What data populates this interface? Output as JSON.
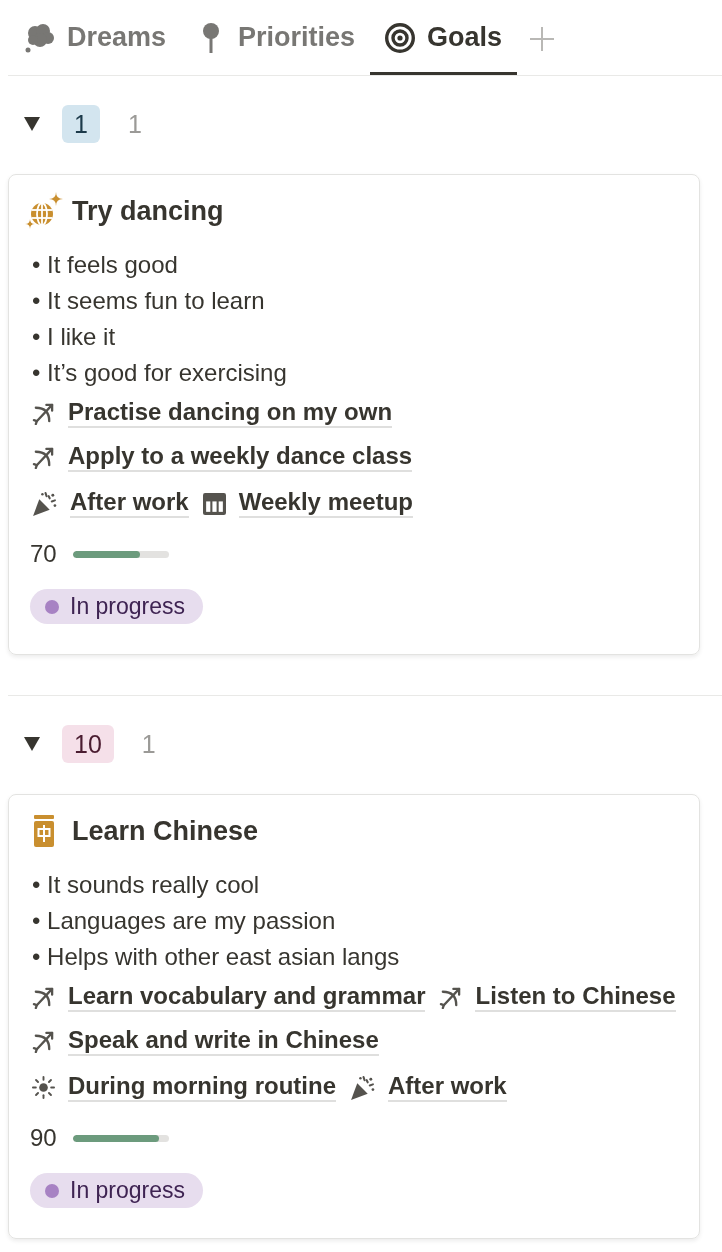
{
  "tabs": [
    {
      "label": "Dreams",
      "kind": "cloud",
      "selected": false
    },
    {
      "label": "Priorities",
      "kind": "pin",
      "selected": false
    },
    {
      "label": "Goals",
      "kind": "target",
      "selected": true
    }
  ],
  "groups": [
    {
      "label": "1",
      "color": "#d3e5ef",
      "count": "1",
      "expanded": true,
      "cards": [
        {
          "title": "Try dancing",
          "kind": "globe",
          "lines": [
            "• It feels good",
            "• It seems fun to learn",
            "• I like it",
            "• It’s good for exercising"
          ],
          "projects": [
            "Practise dancing on my own",
            "Apply to a weekly dance class"
          ],
          "times": [
            {
              "label": "After work",
              "kind": "party"
            },
            {
              "label": "Weekly meetup",
              "kind": "calendar"
            }
          ],
          "progress": {
            "value": "70",
            "level": 0.7
          },
          "status": {
            "label": "In progress",
            "color": "#a782c3"
          }
        }
      ]
    },
    {
      "label": "10",
      "color": "#f5e0e9",
      "count": "1",
      "expanded": true,
      "cards": [
        {
          "title": "Learn Chinese",
          "kind": "tile",
          "lines": [
            "• It sounds really cool",
            "• Languages are my passion",
            "• Helps with other east asian langs"
          ],
          "projects": [
            "Learn vocabulary and grammar",
            "Listen to Chinese",
            "Speak and write in Chinese"
          ],
          "times": [
            {
              "label": "During morning routine",
              "kind": "sun"
            },
            {
              "label": "After work",
              "kind": "party"
            }
          ],
          "progress": {
            "value": "90",
            "level": 0.9
          },
          "status": {
            "label": "In progress",
            "color": "#a782c3"
          }
        }
      ]
    }
  ]
}
